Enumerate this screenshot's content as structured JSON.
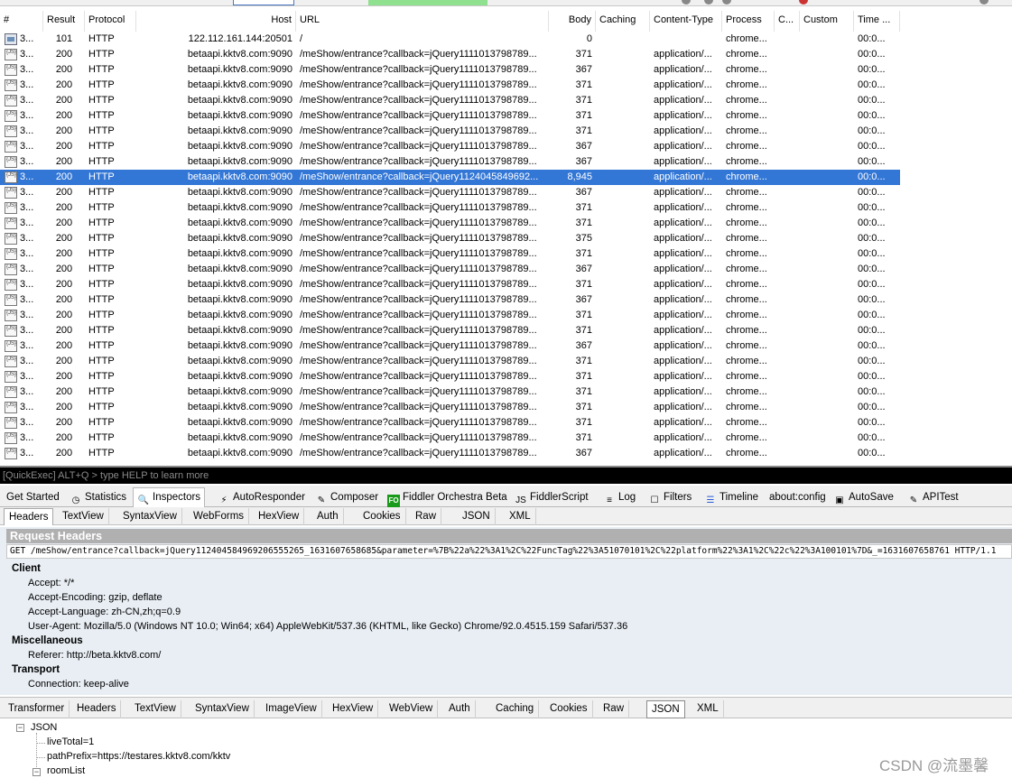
{
  "columns": [
    "#",
    "Result",
    "Protocol",
    "Host",
    "URL",
    "Body",
    "Caching",
    "Content-Type",
    "Process",
    "C...",
    "Custom",
    "Time ..."
  ],
  "sessions": [
    {
      "num": "3...",
      "icon": "img",
      "result": "101",
      "protocol": "HTTP",
      "host": "122.112.161.144:20501",
      "url": "/",
      "body": "0",
      "caching": "",
      "content_type": "",
      "process": "chrome...",
      "time": "00:0..."
    },
    {
      "num": "3...",
      "icon": "js",
      "result": "200",
      "protocol": "HTTP",
      "host": "betaapi.kktv8.com:9090",
      "url": "/meShow/entrance?callback=jQuery1111013798789...",
      "body": "371",
      "caching": "",
      "content_type": "application/...",
      "process": "chrome...",
      "time": "00:0..."
    },
    {
      "num": "3...",
      "icon": "js",
      "result": "200",
      "protocol": "HTTP",
      "host": "betaapi.kktv8.com:9090",
      "url": "/meShow/entrance?callback=jQuery1111013798789...",
      "body": "367",
      "caching": "",
      "content_type": "application/...",
      "process": "chrome...",
      "time": "00:0..."
    },
    {
      "num": "3...",
      "icon": "js",
      "result": "200",
      "protocol": "HTTP",
      "host": "betaapi.kktv8.com:9090",
      "url": "/meShow/entrance?callback=jQuery1111013798789...",
      "body": "371",
      "caching": "",
      "content_type": "application/...",
      "process": "chrome...",
      "time": "00:0..."
    },
    {
      "num": "3...",
      "icon": "js",
      "result": "200",
      "protocol": "HTTP",
      "host": "betaapi.kktv8.com:9090",
      "url": "/meShow/entrance?callback=jQuery1111013798789...",
      "body": "371",
      "caching": "",
      "content_type": "application/...",
      "process": "chrome...",
      "time": "00:0..."
    },
    {
      "num": "3...",
      "icon": "js",
      "result": "200",
      "protocol": "HTTP",
      "host": "betaapi.kktv8.com:9090",
      "url": "/meShow/entrance?callback=jQuery1111013798789...",
      "body": "371",
      "caching": "",
      "content_type": "application/...",
      "process": "chrome...",
      "time": "00:0..."
    },
    {
      "num": "3...",
      "icon": "js",
      "result": "200",
      "protocol": "HTTP",
      "host": "betaapi.kktv8.com:9090",
      "url": "/meShow/entrance?callback=jQuery1111013798789...",
      "body": "371",
      "caching": "",
      "content_type": "application/...",
      "process": "chrome...",
      "time": "00:0..."
    },
    {
      "num": "3...",
      "icon": "js",
      "result": "200",
      "protocol": "HTTP",
      "host": "betaapi.kktv8.com:9090",
      "url": "/meShow/entrance?callback=jQuery1111013798789...",
      "body": "367",
      "caching": "",
      "content_type": "application/...",
      "process": "chrome...",
      "time": "00:0..."
    },
    {
      "num": "3...",
      "icon": "js",
      "result": "200",
      "protocol": "HTTP",
      "host": "betaapi.kktv8.com:9090",
      "url": "/meShow/entrance?callback=jQuery1111013798789...",
      "body": "367",
      "caching": "",
      "content_type": "application/...",
      "process": "chrome...",
      "time": "00:0..."
    },
    {
      "num": "3...",
      "icon": "js",
      "result": "200",
      "protocol": "HTTP",
      "host": "betaapi.kktv8.com:9090",
      "url": "/meShow/entrance?callback=jQuery1124045849692...",
      "body": "8,945",
      "caching": "",
      "content_type": "application/...",
      "process": "chrome...",
      "time": "00:0...",
      "selected": true
    },
    {
      "num": "3...",
      "icon": "js",
      "result": "200",
      "protocol": "HTTP",
      "host": "betaapi.kktv8.com:9090",
      "url": "/meShow/entrance?callback=jQuery1111013798789...",
      "body": "367",
      "caching": "",
      "content_type": "application/...",
      "process": "chrome...",
      "time": "00:0..."
    },
    {
      "num": "3...",
      "icon": "js",
      "result": "200",
      "protocol": "HTTP",
      "host": "betaapi.kktv8.com:9090",
      "url": "/meShow/entrance?callback=jQuery1111013798789...",
      "body": "371",
      "caching": "",
      "content_type": "application/...",
      "process": "chrome...",
      "time": "00:0..."
    },
    {
      "num": "3...",
      "icon": "js",
      "result": "200",
      "protocol": "HTTP",
      "host": "betaapi.kktv8.com:9090",
      "url": "/meShow/entrance?callback=jQuery1111013798789...",
      "body": "371",
      "caching": "",
      "content_type": "application/...",
      "process": "chrome...",
      "time": "00:0..."
    },
    {
      "num": "3...",
      "icon": "js",
      "result": "200",
      "protocol": "HTTP",
      "host": "betaapi.kktv8.com:9090",
      "url": "/meShow/entrance?callback=jQuery1111013798789...",
      "body": "375",
      "caching": "",
      "content_type": "application/...",
      "process": "chrome...",
      "time": "00:0..."
    },
    {
      "num": "3...",
      "icon": "js",
      "result": "200",
      "protocol": "HTTP",
      "host": "betaapi.kktv8.com:9090",
      "url": "/meShow/entrance?callback=jQuery1111013798789...",
      "body": "371",
      "caching": "",
      "content_type": "application/...",
      "process": "chrome...",
      "time": "00:0..."
    },
    {
      "num": "3...",
      "icon": "js",
      "result": "200",
      "protocol": "HTTP",
      "host": "betaapi.kktv8.com:9090",
      "url": "/meShow/entrance?callback=jQuery1111013798789...",
      "body": "367",
      "caching": "",
      "content_type": "application/...",
      "process": "chrome...",
      "time": "00:0..."
    },
    {
      "num": "3...",
      "icon": "js",
      "result": "200",
      "protocol": "HTTP",
      "host": "betaapi.kktv8.com:9090",
      "url": "/meShow/entrance?callback=jQuery1111013798789...",
      "body": "371",
      "caching": "",
      "content_type": "application/...",
      "process": "chrome...",
      "time": "00:0..."
    },
    {
      "num": "3...",
      "icon": "js",
      "result": "200",
      "protocol": "HTTP",
      "host": "betaapi.kktv8.com:9090",
      "url": "/meShow/entrance?callback=jQuery1111013798789...",
      "body": "367",
      "caching": "",
      "content_type": "application/...",
      "process": "chrome...",
      "time": "00:0..."
    },
    {
      "num": "3...",
      "icon": "js",
      "result": "200",
      "protocol": "HTTP",
      "host": "betaapi.kktv8.com:9090",
      "url": "/meShow/entrance?callback=jQuery1111013798789...",
      "body": "371",
      "caching": "",
      "content_type": "application/...",
      "process": "chrome...",
      "time": "00:0..."
    },
    {
      "num": "3...",
      "icon": "js",
      "result": "200",
      "protocol": "HTTP",
      "host": "betaapi.kktv8.com:9090",
      "url": "/meShow/entrance?callback=jQuery1111013798789...",
      "body": "371",
      "caching": "",
      "content_type": "application/...",
      "process": "chrome...",
      "time": "00:0..."
    },
    {
      "num": "3...",
      "icon": "js",
      "result": "200",
      "protocol": "HTTP",
      "host": "betaapi.kktv8.com:9090",
      "url": "/meShow/entrance?callback=jQuery1111013798789...",
      "body": "367",
      "caching": "",
      "content_type": "application/...",
      "process": "chrome...",
      "time": "00:0..."
    },
    {
      "num": "3...",
      "icon": "js",
      "result": "200",
      "protocol": "HTTP",
      "host": "betaapi.kktv8.com:9090",
      "url": "/meShow/entrance?callback=jQuery1111013798789...",
      "body": "371",
      "caching": "",
      "content_type": "application/...",
      "process": "chrome...",
      "time": "00:0..."
    },
    {
      "num": "3...",
      "icon": "js",
      "result": "200",
      "protocol": "HTTP",
      "host": "betaapi.kktv8.com:9090",
      "url": "/meShow/entrance?callback=jQuery1111013798789...",
      "body": "371",
      "caching": "",
      "content_type": "application/...",
      "process": "chrome...",
      "time": "00:0..."
    },
    {
      "num": "3...",
      "icon": "js",
      "result": "200",
      "protocol": "HTTP",
      "host": "betaapi.kktv8.com:9090",
      "url": "/meShow/entrance?callback=jQuery1111013798789...",
      "body": "371",
      "caching": "",
      "content_type": "application/...",
      "process": "chrome...",
      "time": "00:0..."
    },
    {
      "num": "3...",
      "icon": "js",
      "result": "200",
      "protocol": "HTTP",
      "host": "betaapi.kktv8.com:9090",
      "url": "/meShow/entrance?callback=jQuery1111013798789...",
      "body": "371",
      "caching": "",
      "content_type": "application/...",
      "process": "chrome...",
      "time": "00:0..."
    },
    {
      "num": "3...",
      "icon": "js",
      "result": "200",
      "protocol": "HTTP",
      "host": "betaapi.kktv8.com:9090",
      "url": "/meShow/entrance?callback=jQuery1111013798789...",
      "body": "371",
      "caching": "",
      "content_type": "application/...",
      "process": "chrome...",
      "time": "00:0..."
    },
    {
      "num": "3...",
      "icon": "js",
      "result": "200",
      "protocol": "HTTP",
      "host": "betaapi.kktv8.com:9090",
      "url": "/meShow/entrance?callback=jQuery1111013798789...",
      "body": "371",
      "caching": "",
      "content_type": "application/...",
      "process": "chrome...",
      "time": "00:0..."
    },
    {
      "num": "3...",
      "icon": "js",
      "result": "200",
      "protocol": "HTTP",
      "host": "betaapi.kktv8.com:9090",
      "url": "/meShow/entrance?callback=jQuery1111013798789...",
      "body": "367",
      "caching": "",
      "content_type": "application/...",
      "process": "chrome...",
      "time": "00:0..."
    }
  ],
  "quickexec": {
    "placeholder": "[QuickExec] ALT+Q > type HELP to learn more"
  },
  "main_tabs": [
    {
      "label": "Get Started",
      "icon": ""
    },
    {
      "label": "Statistics",
      "icon": "stopwatch-icon"
    },
    {
      "label": "Inspectors",
      "icon": "magnifier-icon"
    },
    {
      "label": "AutoResponder",
      "icon": "lightning-icon"
    },
    {
      "label": "Composer",
      "icon": "pencil-icon"
    },
    {
      "label": "Fiddler Orchestra Beta",
      "icon": "fo-icon"
    },
    {
      "label": "FiddlerScript",
      "icon": "js-icon"
    },
    {
      "label": "Log",
      "icon": "log-icon"
    },
    {
      "label": "Filters",
      "icon": "checkbox-icon"
    },
    {
      "label": "Timeline",
      "icon": "timeline-icon"
    },
    {
      "label": "about:config",
      "icon": ""
    },
    {
      "label": "AutoSave",
      "icon": "autosave-icon"
    },
    {
      "label": "APITest",
      "icon": "apitest-icon"
    }
  ],
  "request_tabs": [
    "Headers",
    "TextView",
    "SyntaxView",
    "WebForms",
    "HexView",
    "Auth",
    "Cookies",
    "Raw",
    "JSON",
    "XML"
  ],
  "request": {
    "title": "Request Headers",
    "line": "GET /meShow/entrance?callback=jQuery112404584969206555265_1631607658685&parameter=%7B%22a%22%3A1%2C%22FuncTag%22%3A51070101%2C%22platform%22%3A1%2C%22c%22%3A100101%7D&_=1631607658761 HTTP/1.1",
    "groups": [
      {
        "name": "Client",
        "items": [
          "Accept: */*",
          "Accept-Encoding: gzip, deflate",
          "Accept-Language: zh-CN,zh;q=0.9",
          "User-Agent: Mozilla/5.0 (Windows NT 10.0; Win64; x64) AppleWebKit/537.36 (KHTML, like Gecko) Chrome/92.0.4515.159 Safari/537.36"
        ]
      },
      {
        "name": "Miscellaneous",
        "items": [
          "Referer: http://beta.kktv8.com/"
        ]
      },
      {
        "name": "Transport",
        "items": [
          "Connection: keep-alive"
        ]
      }
    ]
  },
  "response_tabs": [
    "Transformer",
    "Headers",
    "TextView",
    "SyntaxView",
    "ImageView",
    "HexView",
    "WebView",
    "Auth",
    "Caching",
    "Cookies",
    "Raw",
    "JSON",
    "XML"
  ],
  "json_tree": {
    "root": "JSON",
    "nodes": [
      "liveTotal=1",
      "pathPrefix=https://testares.kktv8.com/kktv",
      "roomList"
    ]
  },
  "watermark": "CSDN @流墨馨"
}
